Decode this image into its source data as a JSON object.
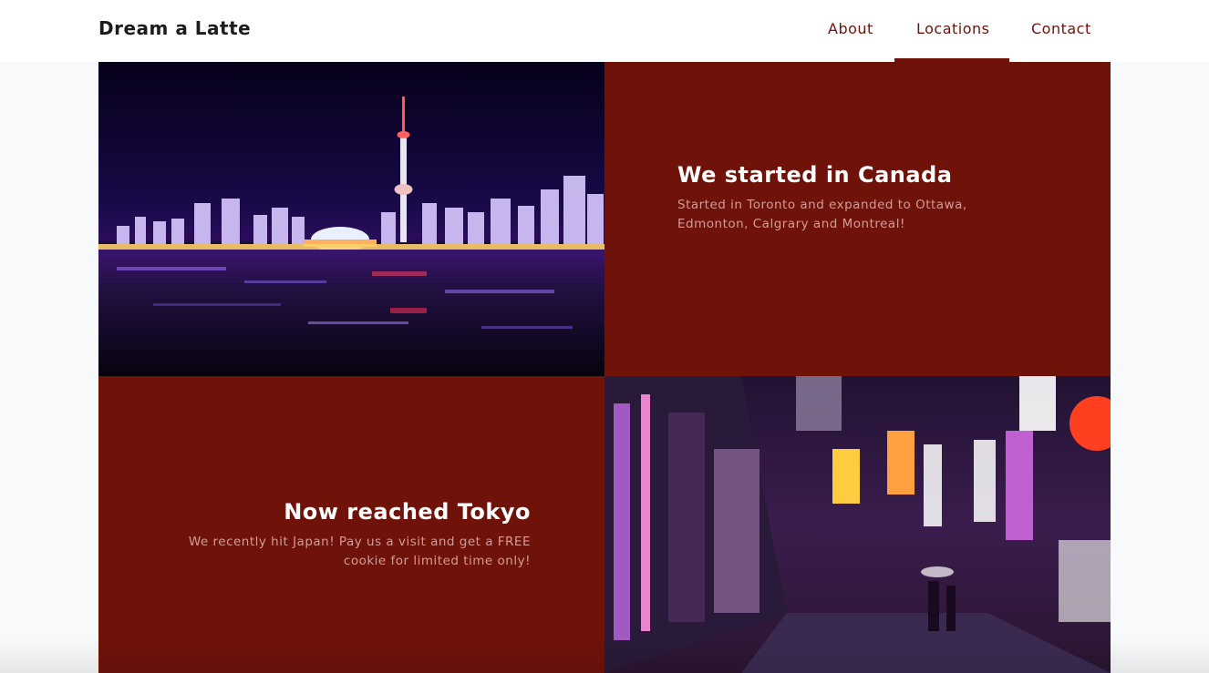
{
  "brand": "Dream a Latte",
  "nav": {
    "about": "About",
    "locations": "Locations",
    "contact": "Contact",
    "active": "Locations"
  },
  "sections": {
    "canada": {
      "heading": "We started in Canada",
      "text": "Started in Toronto and expanded to Ottawa, Edmonton, Calgrary and Montreal!"
    },
    "tokyo": {
      "heading": "Now reached Tokyo",
      "text": "We recently hit Japan! Pay us a visit and get a FREE cookie for limited time only!"
    }
  },
  "colors": {
    "accent": "#6e120a",
    "background": "#f8f9fa",
    "text_muted": "#d29c96"
  },
  "images": {
    "canada": "toronto-night-skyline-image",
    "tokyo": "tokyo-neon-street-image"
  }
}
